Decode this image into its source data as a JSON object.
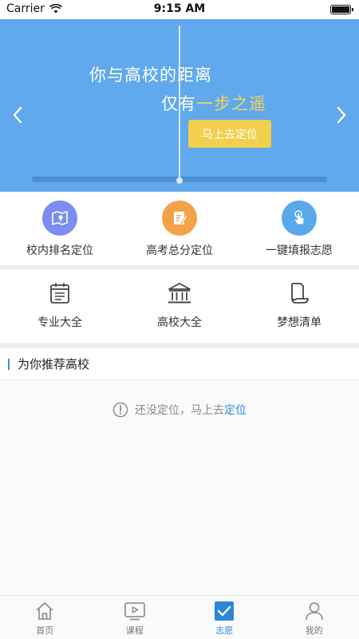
{
  "status_bar": {
    "carrier": "Carrier",
    "time": "9:15 AM"
  },
  "banner": {
    "line1": "你与高校的距离",
    "line2_prefix": "仅有",
    "line2_highlight": "一步之遥",
    "cta_label": "马上去定位",
    "left_arrow": "chevron-left-icon",
    "right_arrow": "chevron-right-icon"
  },
  "features_row1": [
    {
      "label": "校内排名定位",
      "icon": "map-pin-icon",
      "color": "#7b8df0"
    },
    {
      "label": "高考总分定位",
      "icon": "edit-note-icon",
      "color": "#f3a24a"
    },
    {
      "label": "一键填报志愿",
      "icon": "tap-finger-icon",
      "color": "#5aa8ec"
    }
  ],
  "features_row2": [
    {
      "label": "专业大全",
      "icon": "calendar-icon"
    },
    {
      "label": "高校大全",
      "icon": "institution-icon"
    },
    {
      "label": "梦想清单",
      "icon": "document-icon"
    }
  ],
  "recommend": {
    "title": "为你推荐高校",
    "empty_text": "还没定位，马上去",
    "empty_link": "定位"
  },
  "tabbar": {
    "tabs": [
      {
        "label": "首页",
        "icon": "home-icon",
        "active": false
      },
      {
        "label": "课程",
        "icon": "video-icon",
        "active": false
      },
      {
        "label": "志愿",
        "icon": "check-square-icon",
        "active": true
      },
      {
        "label": "我的",
        "icon": "user-icon",
        "active": false
      }
    ]
  },
  "colors": {
    "banner_bg": "#5fa9ec",
    "cta": "#f2cf4e",
    "accent": "#2f86d8"
  }
}
